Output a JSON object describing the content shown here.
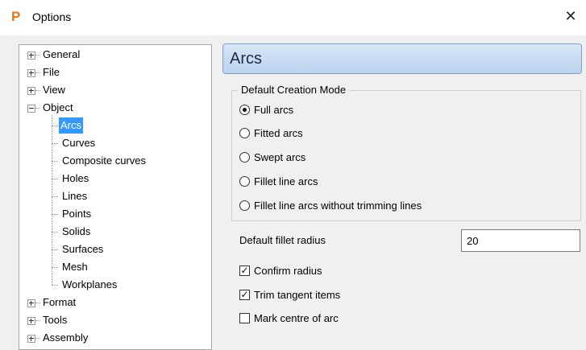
{
  "window": {
    "title": "Options",
    "app_icon": "P",
    "close": "✕"
  },
  "tree": {
    "top_items": [
      {
        "label": "General",
        "expander": "plus"
      },
      {
        "label": "File",
        "expander": "plus"
      },
      {
        "label": "View",
        "expander": "plus"
      },
      {
        "label": "Object",
        "expander": "minus"
      }
    ],
    "object_children": [
      "Arcs",
      "Curves",
      "Composite curves",
      "Holes",
      "Lines",
      "Points",
      "Solids",
      "Surfaces",
      "Mesh",
      "Workplanes"
    ],
    "selected": "Arcs",
    "bottom_items": [
      {
        "label": "Format",
        "expander": "plus"
      },
      {
        "label": "Tools",
        "expander": "plus"
      },
      {
        "label": "Assembly",
        "expander": "plus"
      }
    ]
  },
  "panel": {
    "title": "Arcs",
    "creation_mode": {
      "legend": "Default Creation Mode",
      "options": [
        {
          "label": "Full arcs",
          "selected": true
        },
        {
          "label": "Fitted arcs",
          "selected": false
        },
        {
          "label": "Swept arcs",
          "selected": false
        },
        {
          "label": "Fillet line arcs",
          "selected": false
        },
        {
          "label": "Fillet line arcs without trimming lines",
          "selected": false
        }
      ]
    },
    "fillet_radius": {
      "label": "Default fillet radius",
      "value": "20"
    },
    "checkboxes": [
      {
        "label": "Confirm radius",
        "checked": true
      },
      {
        "label": "Trim tangent items",
        "checked": true
      },
      {
        "label": "Mark centre of arc",
        "checked": false
      }
    ]
  }
}
